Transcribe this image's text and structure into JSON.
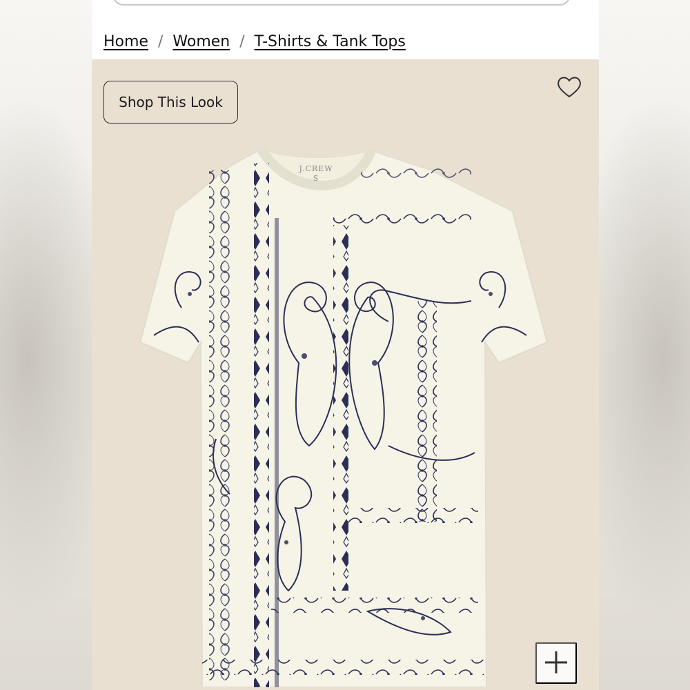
{
  "breadcrumb": {
    "items": [
      "Home",
      "Women",
      "T-Shirts & Tank Tops"
    ],
    "separator": "/"
  },
  "product": {
    "shop_look_label": "Shop This Look",
    "brand_label": "J.CREW",
    "size_label": "S",
    "icons": {
      "favorite": "heart-icon",
      "zoom": "plus-icon"
    }
  },
  "colors": {
    "product_bg": "#e9e0d2",
    "shirt": "#f6f3e7",
    "print": "#2c2f55"
  }
}
